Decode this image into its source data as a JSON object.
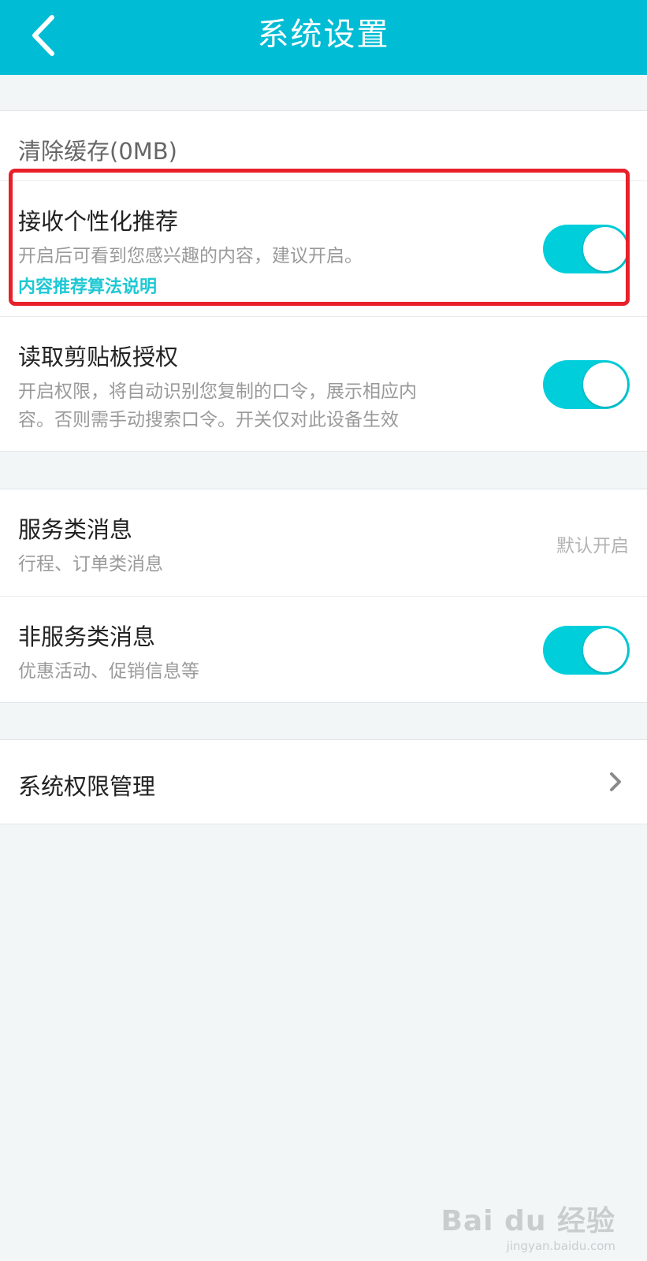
{
  "header": {
    "title": "系统设置",
    "back_icon": "chevron-left-icon",
    "background_color": "#00bcd4"
  },
  "cache": {
    "label": "清除缓存(0MB)"
  },
  "personalized": {
    "title": "接收个性化推荐",
    "description": "开启后可看到您感兴趣的内容，建议开启。",
    "link": "内容推荐算法说明",
    "enabled": true
  },
  "clipboard": {
    "title": "读取剪贴板授权",
    "description_line1": "开启权限，将自动识别您复制的口令，展示相应内",
    "description_line2": "容。否则需手动搜索口令。开关仅对此设备生效",
    "enabled": true
  },
  "service_msg": {
    "title": "服务类消息",
    "description": "行程、订单类消息",
    "value": "默认开启"
  },
  "non_service_msg": {
    "title": "非服务类消息",
    "description": "优惠活动、促销信息等",
    "enabled": true
  },
  "permissions": {
    "title": "系统权限管理",
    "icon": "chevron-right-icon"
  },
  "watermark": {
    "main": "Bai du 经验",
    "sub": "jingyan.baidu.com"
  },
  "colors": {
    "toggle_on": "#00cfdb",
    "link": "#1ec8d3",
    "highlight": "#e8202a"
  }
}
